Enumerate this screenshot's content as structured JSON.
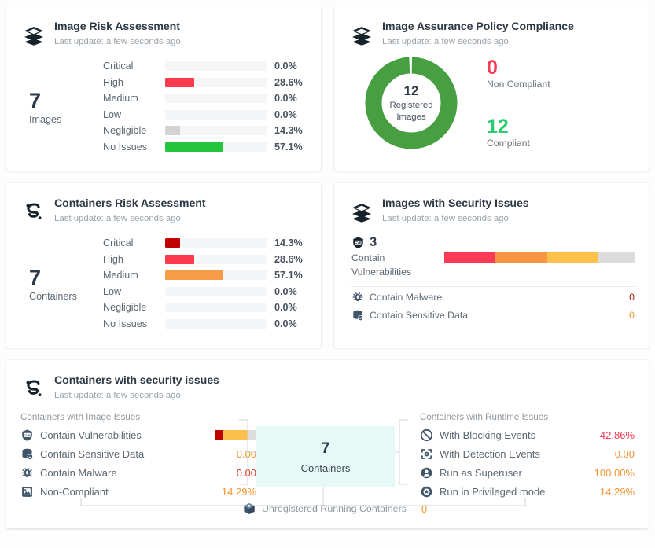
{
  "colors": {
    "critical": "#c10000",
    "high": "#fb3a4e",
    "medium": "#f89c46",
    "low": "#fdc04a",
    "negligible": "#d3d3d3",
    "no_issues": "#24c43c",
    "green": "#479f42",
    "green_text": "#2ecc71",
    "red_text": "#fb3a55",
    "orange_text": "#f5932f",
    "dark_red_text": "#b31515",
    "track": "#f4f5f7",
    "gray_seg": "#dcdcdc",
    "center_box": "#e6f9f6"
  },
  "cards": {
    "image_risk": {
      "title": "Image Risk Assessment",
      "subtitle": "Last update: a few seconds ago",
      "icon": "layers-icon",
      "total": "7",
      "total_label": "Images",
      "chart_data": {
        "type": "bar",
        "title": "Image Risk Assessment",
        "categories": [
          "Critical",
          "High",
          "Medium",
          "Low",
          "Negligible",
          "No Issues"
        ],
        "values": [
          0.0,
          28.6,
          0.0,
          0.0,
          14.3,
          57.1
        ],
        "value_labels": [
          "0.0%",
          "28.6%",
          "0.0%",
          "0.0%",
          "14.3%",
          "57.1%"
        ],
        "xlabel": "",
        "ylabel": "",
        "ylim": [
          0,
          100
        ],
        "orientation": "horizontal",
        "bar_colors": [
          "#c10000",
          "#fb3a4e",
          "#f89c46",
          "#fdc04a",
          "#d3d3d3",
          "#24c43c"
        ]
      }
    },
    "policy_compliance": {
      "title": "Image Assurance Policy Compliance",
      "subtitle": "Last update: a few seconds ago",
      "icon": "layers-icon",
      "chart_data": {
        "type": "pie",
        "title": "Image Assurance Policy Compliance",
        "labels": [
          "Compliant",
          "Non Compliant"
        ],
        "values": [
          12,
          0
        ],
        "colors": [
          "#479f42",
          "#ffffff"
        ],
        "center_value": "12",
        "center_label_line1": "Registered",
        "center_label_line2": "Images"
      },
      "stats": [
        {
          "value": "0",
          "label": "Non Compliant",
          "color": "#fb3a55"
        },
        {
          "value": "12",
          "label": "Compliant",
          "color": "#2ecc71"
        }
      ]
    },
    "containers_risk": {
      "title": "Containers Risk Assessment",
      "subtitle": "Last update: a few seconds ago",
      "icon": "container-logo-icon",
      "total": "7",
      "total_label": "Containers",
      "chart_data": {
        "type": "bar",
        "title": "Containers Risk Assessment",
        "categories": [
          "Critical",
          "High",
          "Medium",
          "Low",
          "Negligible",
          "No Issues"
        ],
        "values": [
          14.3,
          28.6,
          57.1,
          0.0,
          0.0,
          0.0
        ],
        "value_labels": [
          "14.3%",
          "28.6%",
          "57.1%",
          "0.0%",
          "0.0%",
          "0.0%"
        ],
        "xlabel": "",
        "ylabel": "",
        "ylim": [
          0,
          100
        ],
        "orientation": "horizontal",
        "bar_colors": [
          "#c10000",
          "#fb3a4e",
          "#f89c46",
          "#fdc04a",
          "#d3d3d3",
          "#24c43c"
        ]
      }
    },
    "images_security": {
      "title": "Images with Security Issues",
      "subtitle": "Last update: a few seconds ago",
      "icon": "layers-icon",
      "vuln_icon": "cve-shield-icon",
      "vuln_count": "3",
      "vuln_caption_line1": "Contain",
      "vuln_caption_line2": "Vulnerabilities",
      "chart_data": {
        "type": "bar",
        "title": "Images with Security Issues - severity distribution",
        "categories": [
          "High",
          "Medium",
          "Low",
          "Remaining"
        ],
        "values": [
          27,
          27,
          27,
          19
        ],
        "colors": [
          "#fb3a55",
          "#fb9445",
          "#fdc04a",
          "#dcdcdc"
        ],
        "stacked": true
      },
      "rows": [
        {
          "icon": "malware-bug-icon",
          "label": "Contain Malware",
          "value": "0",
          "color": "#b31515"
        },
        {
          "icon": "sensitive-data-icon",
          "label": "Contain Sensitive Data",
          "value": "0",
          "color": "#f5932f"
        }
      ]
    },
    "containers_security": {
      "title": "Containers with security issues",
      "subtitle": "Last update: a few seconds ago",
      "icon": "container-logo-icon",
      "left_group_title": "Containers with Image Issues",
      "left_rows": [
        {
          "icon": "cve-shield-icon",
          "label": "Contain Vulnerabilities",
          "value": "",
          "has_bar": true,
          "color": "#5c6872"
        },
        {
          "icon": "sensitive-data-icon",
          "label": "Contain Sensitive Data",
          "value": "0.00",
          "has_bar": false,
          "color": "#f5932f"
        },
        {
          "icon": "malware-bug-icon",
          "label": "Contain Malware",
          "value": "0.00",
          "has_bar": false,
          "color": "#e03a28"
        },
        {
          "icon": "non-compliant-icon",
          "label": "Non-Compliant",
          "value": "14.29%",
          "has_bar": false,
          "color": "#f5932f"
        }
      ],
      "mini_bar": {
        "type": "bar",
        "stacked": true,
        "categories": [
          "Critical",
          "Medium",
          "Remaining"
        ],
        "values": [
          20,
          60,
          20
        ],
        "colors": [
          "#c10000",
          "#fdc04a",
          "#dcdcdc"
        ]
      },
      "center_value": "7",
      "center_label": "Containers",
      "right_group_title": "Containers with Runtime Issues",
      "right_rows": [
        {
          "icon": "blocking-events-icon",
          "label": "With Blocking Events",
          "value": "42.86%",
          "color": "#fb3a55"
        },
        {
          "icon": "detection-events-icon",
          "label": "With Detection Events",
          "value": "0.00",
          "color": "#f5932f"
        },
        {
          "icon": "superuser-icon",
          "label": "Run as Superuser",
          "value": "100.00%",
          "color": "#f5932f"
        },
        {
          "icon": "privileged-mode-icon",
          "label": "Run in Privileged mode",
          "value": "14.29%",
          "color": "#f5932f"
        }
      ],
      "bottom_row": {
        "icon": "unregistered-container-icon",
        "label": "Unregistered Running Containers",
        "value": "0",
        "color": "#f5932f"
      }
    }
  }
}
